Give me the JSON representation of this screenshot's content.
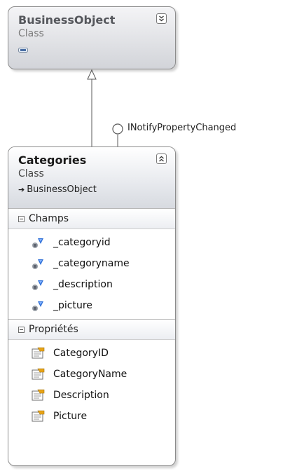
{
  "base_class": {
    "name": "BusinessObject",
    "kind": "Class"
  },
  "interface": {
    "name": "INotifyPropertyChanged"
  },
  "main_class": {
    "name": "Categories",
    "kind": "Class",
    "parent": "BusinessObject",
    "fields_header": "Champs",
    "fields": [
      "_categoryid",
      "_categoryname",
      "_description",
      "_picture"
    ],
    "properties_header": "Propriétés",
    "properties": [
      "CategoryID",
      "CategoryName",
      "Description",
      "Picture"
    ]
  }
}
